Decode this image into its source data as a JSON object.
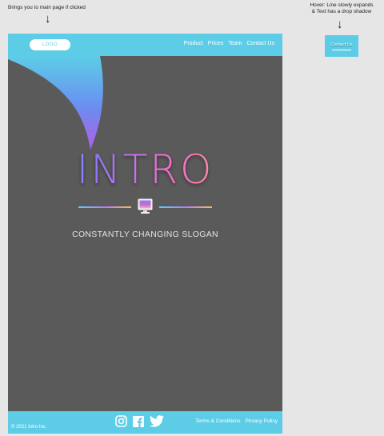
{
  "annotations": {
    "logo_note": "Brings you to main page if clicked",
    "hover_note_line1": "Hover: Line slowly expands",
    "hover_note_line2": "& Text has a drop shadow"
  },
  "hover_demo": {
    "label": "Contact Us"
  },
  "navbar": {
    "logo_label": "LOGO",
    "links": [
      "Product",
      "Prices",
      "Team",
      "Contact Us"
    ]
  },
  "hero": {
    "title": "INTRO",
    "slogan": "CONSTANTLY CHANGING SLOGAN",
    "icon": "monitor-icon"
  },
  "footer": {
    "copyright": "© 2021 Intro Inc.",
    "social_icons": [
      "instagram-icon",
      "facebook-icon",
      "twitter-icon"
    ],
    "links": [
      "Terms & Conditions",
      "Privacy Policy"
    ]
  },
  "colors": {
    "accent": "#5dcde7",
    "background": "#5a5a5a",
    "page": "#e6e6e6"
  }
}
